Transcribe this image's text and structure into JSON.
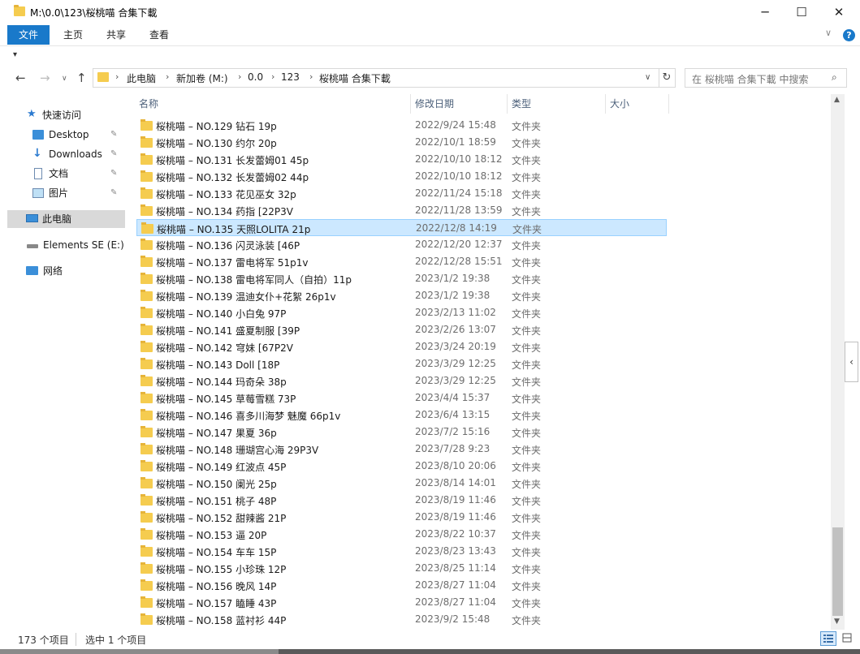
{
  "window": {
    "title": "M:\\0.0\\123\\桜桃喵 合集下載",
    "minimize": "─",
    "maximize": "☐",
    "close": "✕"
  },
  "ribbon": {
    "tabs": [
      "文件",
      "主页",
      "共享",
      "查看"
    ],
    "help": "?",
    "expand": "∨"
  },
  "quick_access_toolbar": {
    "dropdown": "▾"
  },
  "navigation": {
    "back": "←",
    "forward": "→",
    "recent": "∨",
    "up": "↑",
    "breadcrumb": [
      "此电脑",
      "新加卷 (M:)",
      "0.0",
      "123",
      "桜桃喵 合集下載"
    ],
    "refresh": "↻"
  },
  "search": {
    "placeholder": "在 桜桃喵 合集下載 中搜索"
  },
  "sidebar": {
    "items": [
      {
        "label": "快速访问",
        "icon": "star-icon"
      },
      {
        "label": "Desktop",
        "icon": "desktop-icon",
        "pinned": true
      },
      {
        "label": "Downloads",
        "icon": "download-icon",
        "pinned": true
      },
      {
        "label": "文档",
        "icon": "document-icon",
        "pinned": true
      },
      {
        "label": "图片",
        "icon": "picture-icon",
        "pinned": true
      },
      {
        "label": "此电脑",
        "icon": "computer-icon",
        "selected": true
      },
      {
        "label": "Elements SE (E:)",
        "icon": "drive-icon"
      },
      {
        "label": "网络",
        "icon": "network-icon"
      }
    ]
  },
  "columns": {
    "name": "名称",
    "date": "修改日期",
    "type": "类型",
    "size": "大小"
  },
  "files": [
    {
      "name": "桜桃喵 – NO.129 钻石 19p",
      "date": "2022/9/24 15:48",
      "type": "文件夹"
    },
    {
      "name": "桜桃喵 – NO.130 约尔 20p",
      "date": "2022/10/1 18:59",
      "type": "文件夹"
    },
    {
      "name": "桜桃喵 – NO.131 长发蕾姆01 45p",
      "date": "2022/10/10 18:12",
      "type": "文件夹"
    },
    {
      "name": "桜桃喵 – NO.132 长发蕾姆02 44p",
      "date": "2022/10/10 18:12",
      "type": "文件夹"
    },
    {
      "name": "桜桃喵 – NO.133 花见巫女 32p",
      "date": "2022/11/24 15:18",
      "type": "文件夹"
    },
    {
      "name": "桜桃喵 – NO.134 药指 [22P3V",
      "date": "2022/11/28 13:59",
      "type": "文件夹"
    },
    {
      "name": "桜桃喵 – NO.135 天照LOLITA 21p",
      "date": "2022/12/8 14:19",
      "type": "文件夹",
      "selected": true
    },
    {
      "name": "桜桃喵 – NO.136 闪灵泳装 [46P",
      "date": "2022/12/20 12:37",
      "type": "文件夹"
    },
    {
      "name": "桜桃喵 – NO.137 雷电将军 51p1v",
      "date": "2022/12/28 15:51",
      "type": "文件夹"
    },
    {
      "name": "桜桃喵 – NO.138 雷电将军同人（自拍）11p",
      "date": "2023/1/2 19:38",
      "type": "文件夹"
    },
    {
      "name": "桜桃喵 – NO.139 温迪女仆+花絮 26p1v",
      "date": "2023/1/2 19:38",
      "type": "文件夹"
    },
    {
      "name": "桜桃喵 – NO.140 小白兔 97P",
      "date": "2023/2/13 11:02",
      "type": "文件夹"
    },
    {
      "name": "桜桃喵 – NO.141 盛夏制服 [39P",
      "date": "2023/2/26 13:07",
      "type": "文件夹"
    },
    {
      "name": "桜桃喵 – NO.142 穹妹 [67P2V",
      "date": "2023/3/24 20:19",
      "type": "文件夹"
    },
    {
      "name": "桜桃喵 – NO.143 Doll [18P",
      "date": "2023/3/29 12:25",
      "type": "文件夹"
    },
    {
      "name": "桜桃喵 – NO.144 玛奇朵 38p",
      "date": "2023/3/29 12:25",
      "type": "文件夹"
    },
    {
      "name": "桜桃喵 – NO.145 草莓雪糕 73P",
      "date": "2023/4/4 15:37",
      "type": "文件夹"
    },
    {
      "name": "桜桃喵 – NO.146 喜多川海梦 魅魔 66p1v",
      "date": "2023/6/4 13:15",
      "type": "文件夹"
    },
    {
      "name": "桜桃喵 – NO.147 果夏 36p",
      "date": "2023/7/2 15:16",
      "type": "文件夹"
    },
    {
      "name": "桜桃喵 – NO.148 珊瑚宫心海 29P3V",
      "date": "2023/7/28 9:23",
      "type": "文件夹"
    },
    {
      "name": "桜桃喵 – NO.149 红波点 45P",
      "date": "2023/8/10 20:06",
      "type": "文件夹"
    },
    {
      "name": "桜桃喵 – NO.150 阑光 25p",
      "date": "2023/8/14 14:01",
      "type": "文件夹"
    },
    {
      "name": "桜桃喵 – NO.151 桃子 48P",
      "date": "2023/8/19 11:46",
      "type": "文件夹"
    },
    {
      "name": "桜桃喵 – NO.152 甜辣酱 21P",
      "date": "2023/8/19 11:46",
      "type": "文件夹"
    },
    {
      "name": "桜桃喵 – NO.153 逼 20P",
      "date": "2023/8/22 10:37",
      "type": "文件夹"
    },
    {
      "name": "桜桃喵 – NO.154 车车 15P",
      "date": "2023/8/23 13:43",
      "type": "文件夹"
    },
    {
      "name": "桜桃喵 – NO.155 小珍珠 12P",
      "date": "2023/8/25 11:14",
      "type": "文件夹"
    },
    {
      "name": "桜桃喵 – NO.156 晚风 14P",
      "date": "2023/8/27 11:04",
      "type": "文件夹"
    },
    {
      "name": "桜桃喵 – NO.157 瞌睡 43P",
      "date": "2023/8/27 11:04",
      "type": "文件夹"
    },
    {
      "name": "桜桃喵 – NO.158 蓝衬衫 44P",
      "date": "2023/9/2 15:48",
      "type": "文件夹"
    }
  ],
  "status": {
    "item_count": "173 个项目",
    "selected": "选中 1 个项目"
  },
  "colors": {
    "accent": "#1979ca",
    "selection": "#cce8ff",
    "folder": "#f5cc4f"
  }
}
